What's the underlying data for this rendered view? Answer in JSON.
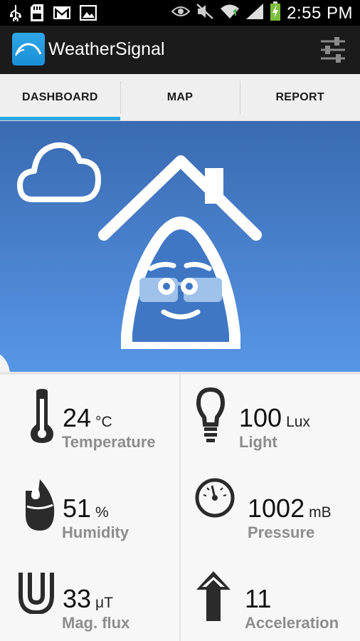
{
  "status_bar": {
    "time": "2:55 PM",
    "left_icons": [
      "usb-icon",
      "sd-card-icon",
      "gmail-icon",
      "image-icon"
    ],
    "right_icons": [
      "eye-icon",
      "mute-icon",
      "wifi-icon",
      "signal-icon",
      "battery-charging-icon"
    ]
  },
  "app_bar": {
    "title": "WeatherSignal",
    "icon": "weathersignal-logo-icon",
    "action_icon": "settings-sliders-icon"
  },
  "tabs": [
    {
      "label": "DASHBOARD",
      "active": true
    },
    {
      "label": "MAP",
      "active": false
    },
    {
      "label": "REPORT",
      "active": false
    }
  ],
  "hero": {
    "weather_icon": "cloud-icon",
    "mascot": "house-mascot-illustration",
    "side_handle_icon": "chevron-right-icon"
  },
  "sensors": [
    {
      "value": "24",
      "unit": "°C",
      "label": "Temperature",
      "icon": "thermometer-icon"
    },
    {
      "value": "100",
      "unit": "Lux",
      "label": "Light",
      "icon": "lightbulb-icon"
    },
    {
      "value": "51",
      "unit": "%",
      "label": "Humidity",
      "icon": "humidity-drop-icon"
    },
    {
      "value": "1002",
      "unit": "mB",
      "label": "Pressure",
      "icon": "barometer-gauge-icon"
    },
    {
      "value": "33",
      "unit": "μT",
      "label": "Mag. flux",
      "icon": "magnet-icon"
    },
    {
      "value": "11",
      "unit": "",
      "label": "Acceleration",
      "icon": "up-arrow-icon"
    }
  ],
  "colors": {
    "tab_indicator": "#2aa6e2",
    "hero_top": "#3a6ab1",
    "hero_bottom": "#5796e6",
    "label_gray": "#8d8d8d"
  }
}
